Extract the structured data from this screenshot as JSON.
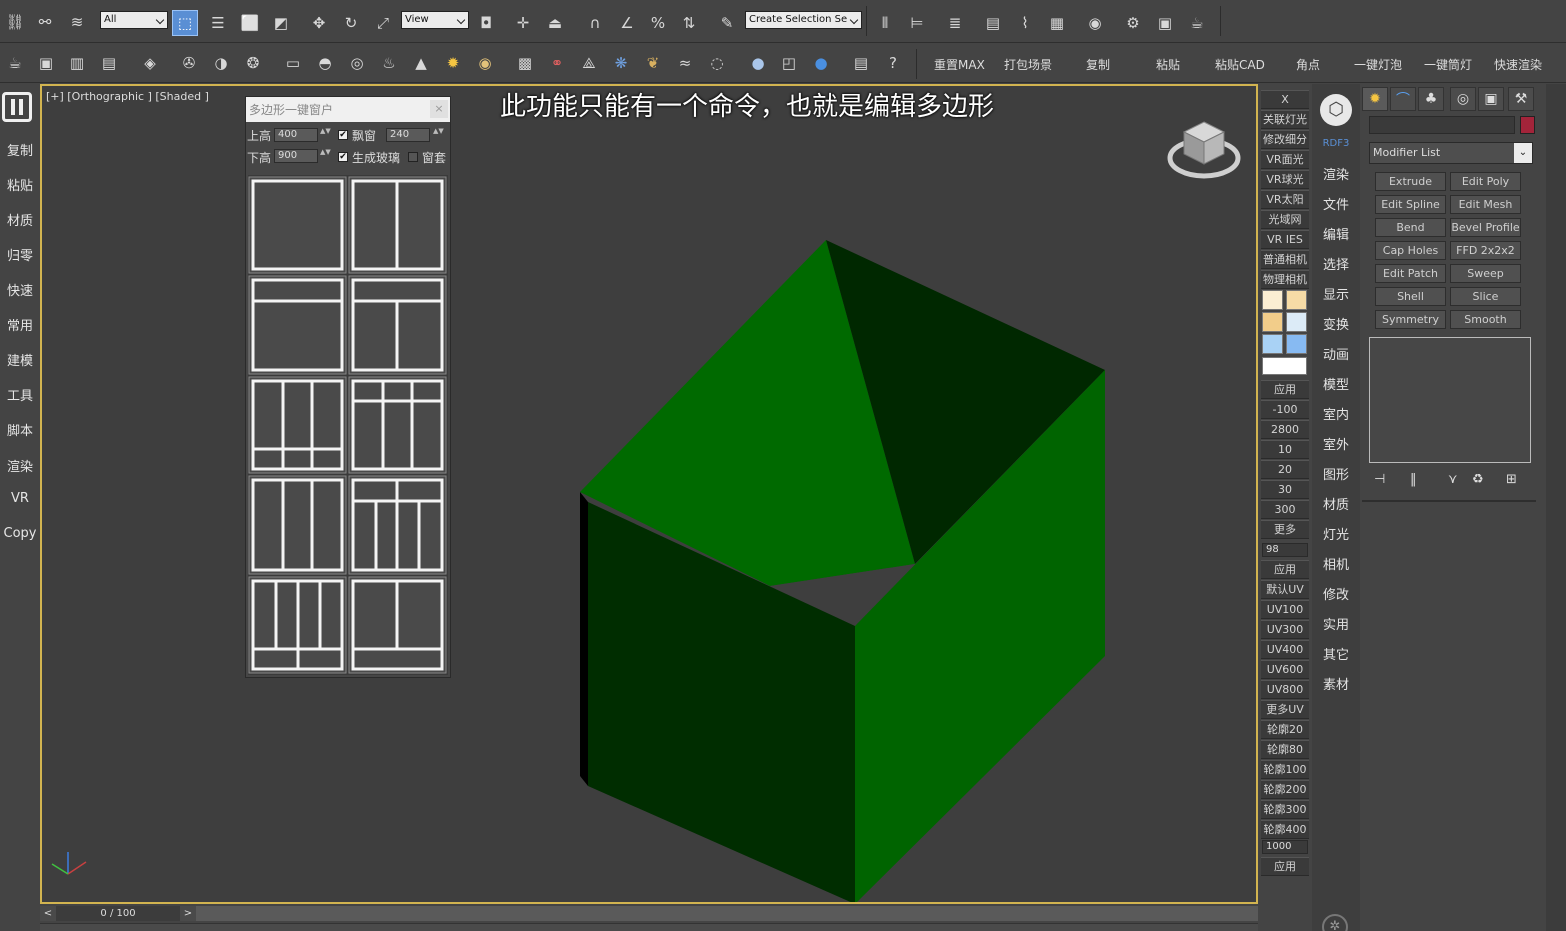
{
  "toolbar": {
    "filter_value": "All",
    "ref_coord_value": "View",
    "selection_set_placeholder": "Create Selection Se",
    "icons1": [
      "link-icon",
      "unlink-icon",
      "bind-spacewarp-icon",
      "select-object-icon",
      "select-by-name-icon",
      "rectangular-region-icon",
      "window-crossing-icon",
      "move-icon",
      "rotate-icon",
      "scale-icon",
      "pivot-center-icon",
      "select-manipulate-icon",
      "keyboard-shortcut-icon",
      "snap-3d-icon",
      "angle-snap-icon",
      "percent-snap-icon",
      "spinner-snap-icon",
      "edit-named-sets-icon",
      "mirror-icon",
      "align-icon",
      "layer-manager-icon",
      "scene-explorer-icon",
      "curve-editor-icon",
      "schematic-view-icon",
      "material-editor-icon",
      "render-setup-icon",
      "rendered-frame-icon",
      "render-production-icon"
    ],
    "icons2": [
      "teapot-icon",
      "render-frame-icon",
      "notes-icon",
      "list-icon",
      "tag-icon",
      "camera-icon",
      "half-sphere-icon",
      "film-icon",
      "plane-icon",
      "dome-icon",
      "sphere-icon",
      "teapot-object-icon",
      "cone-icon",
      "sun-icon",
      "light-disc-icon",
      "grid-icon",
      "molecule-icon",
      "geometry-icon",
      "gear-blue-icon",
      "plant-icon",
      "hair-icon",
      "spiral-icon",
      "globe-icon",
      "camera-box-icon",
      "blue-sphere-icon",
      "clipboard-icon",
      "help-icon"
    ],
    "labels": [
      "重置MAX",
      "打包场景",
      "复制",
      "粘贴",
      "粘贴CAD",
      "角点",
      "一键灯泡",
      "一键筒灯",
      "快速渲染"
    ]
  },
  "left_strip": {
    "items": [
      "复制",
      "粘贴",
      "材质",
      "归零",
      "快速",
      "常用",
      "建模",
      "工具",
      "脚本",
      "渲染",
      "VR",
      "Copy"
    ]
  },
  "viewport": {
    "label": "[+] [Orthographic ] [Shaded ]",
    "caption": "此功能只能有一个命令，也就是编辑多边形"
  },
  "float_window": {
    "title": "多边形一键窗户",
    "close": "×",
    "top_height_label": "上高",
    "top_height_value": "400",
    "bay_window_label": "飘窗",
    "bay_window_value": "240",
    "bottom_height_label": "下高",
    "bottom_height_value": "900",
    "glass_label": "生成玻璃",
    "frame_label": "窗套",
    "bay_checked": true,
    "glass_checked": true,
    "frame_checked": false
  },
  "timeline": {
    "frame": "0 / 100",
    "prev": "<",
    "next": ">"
  },
  "right_script": {
    "top_buttons": [
      "X",
      "关联灯光",
      "修改细分",
      "VR面光",
      "VR球光",
      "VR太阳",
      "光域网",
      "VR IES",
      "普通相机",
      "物理相机"
    ],
    "swatches": [
      "#fbeed3",
      "#f6dba6",
      "#f2cd8a",
      "#dcebf7",
      "#a9d2f5",
      "#87baf2",
      "#ffffff"
    ],
    "buttons2": [
      "应用",
      "-100",
      "2800",
      "10",
      "20",
      "30",
      "300",
      "更多"
    ],
    "input1": "98",
    "buttons3": [
      "应用",
      "默认UV",
      "UV100",
      "UV300",
      "UV400",
      "UV600",
      "UV800",
      "更多UV",
      "轮廓20",
      "轮廓80",
      "轮廓100",
      "轮廓200",
      "轮廓300",
      "轮廓400"
    ],
    "input2": "1000",
    "apply": "应用"
  },
  "menu_cats": {
    "rdf": "RDF3",
    "items": [
      "渲染",
      "文件",
      "编辑",
      "选择",
      "显示",
      "变换",
      "动画",
      "模型",
      "室内",
      "室外",
      "图形",
      "材质",
      "灯光",
      "相机",
      "修改",
      "实用",
      "其它",
      "素材"
    ]
  },
  "command_panel": {
    "tabs": [
      "create-icon",
      "modify-icon",
      "hierarchy-icon",
      "motion-icon",
      "display-icon",
      "utilities-icon"
    ],
    "color": "#a3243a",
    "modifier_list": "Modifier List",
    "modifiers": [
      "Extrude",
      "Edit Poly",
      "Edit Spline",
      "Edit Mesh",
      "Bend",
      "Bevel Profile",
      "Cap Holes",
      "FFD 2x2x2",
      "Edit Patch",
      "Sweep",
      "Shell",
      "Slice",
      "Symmetry",
      "Smooth"
    ]
  }
}
